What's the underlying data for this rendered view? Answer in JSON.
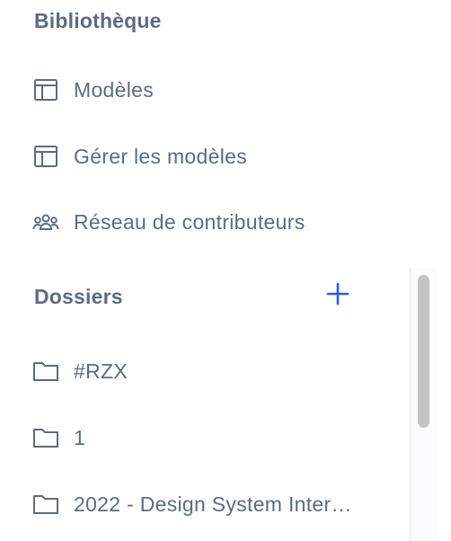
{
  "library": {
    "title": "Bibliothèque",
    "items": [
      {
        "label": "Modèles",
        "icon": "template-icon"
      },
      {
        "label": "Gérer les modèles",
        "icon": "template-icon"
      },
      {
        "label": "Réseau de contributeurs",
        "icon": "users-icon"
      }
    ]
  },
  "folders": {
    "title": "Dossiers",
    "add_icon": "plus-icon",
    "items": [
      {
        "label": "#RZX",
        "icon": "folder-icon"
      },
      {
        "label": "1",
        "icon": "folder-icon"
      },
      {
        "label": "2022 - Design System Inter…",
        "icon": "folder-icon"
      }
    ]
  },
  "colors": {
    "text": "#5d6b82",
    "accent": "#2f5ce0"
  }
}
